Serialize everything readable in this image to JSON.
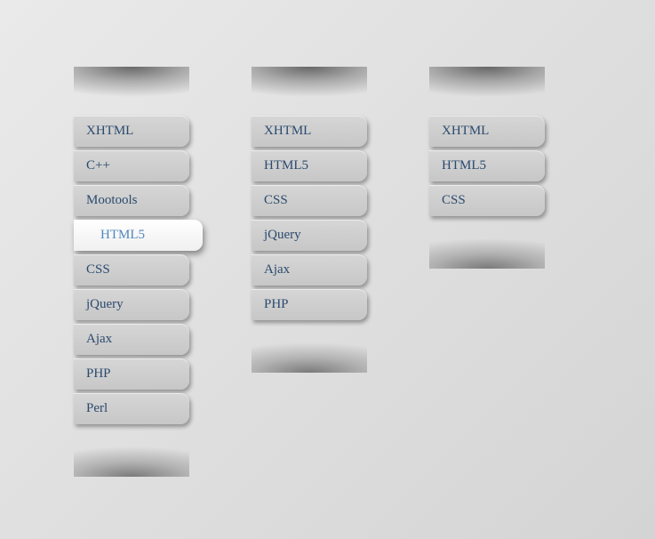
{
  "colors": {
    "text": "#2b4a6e",
    "active_text": "#4f87bf",
    "tab_bg_top": "#d6d6d6",
    "tab_bg_bottom": "#c7c7c7",
    "active_bg": "#ffffff"
  },
  "columns": [
    {
      "items": [
        {
          "label": "XHTML",
          "active": false
        },
        {
          "label": "C++",
          "active": false
        },
        {
          "label": "Mootools",
          "active": false
        },
        {
          "label": "HTML5",
          "active": true
        },
        {
          "label": "CSS",
          "active": false
        },
        {
          "label": "jQuery",
          "active": false
        },
        {
          "label": "Ajax",
          "active": false
        },
        {
          "label": "PHP",
          "active": false
        },
        {
          "label": "Perl",
          "active": false
        }
      ]
    },
    {
      "items": [
        {
          "label": "XHTML",
          "active": false
        },
        {
          "label": "HTML5",
          "active": false
        },
        {
          "label": "CSS",
          "active": false
        },
        {
          "label": "jQuery",
          "active": false
        },
        {
          "label": "Ajax",
          "active": false
        },
        {
          "label": "PHP",
          "active": false
        }
      ]
    },
    {
      "items": [
        {
          "label": "XHTML",
          "active": false
        },
        {
          "label": "HTML5",
          "active": false
        },
        {
          "label": "CSS",
          "active": false
        }
      ]
    }
  ]
}
